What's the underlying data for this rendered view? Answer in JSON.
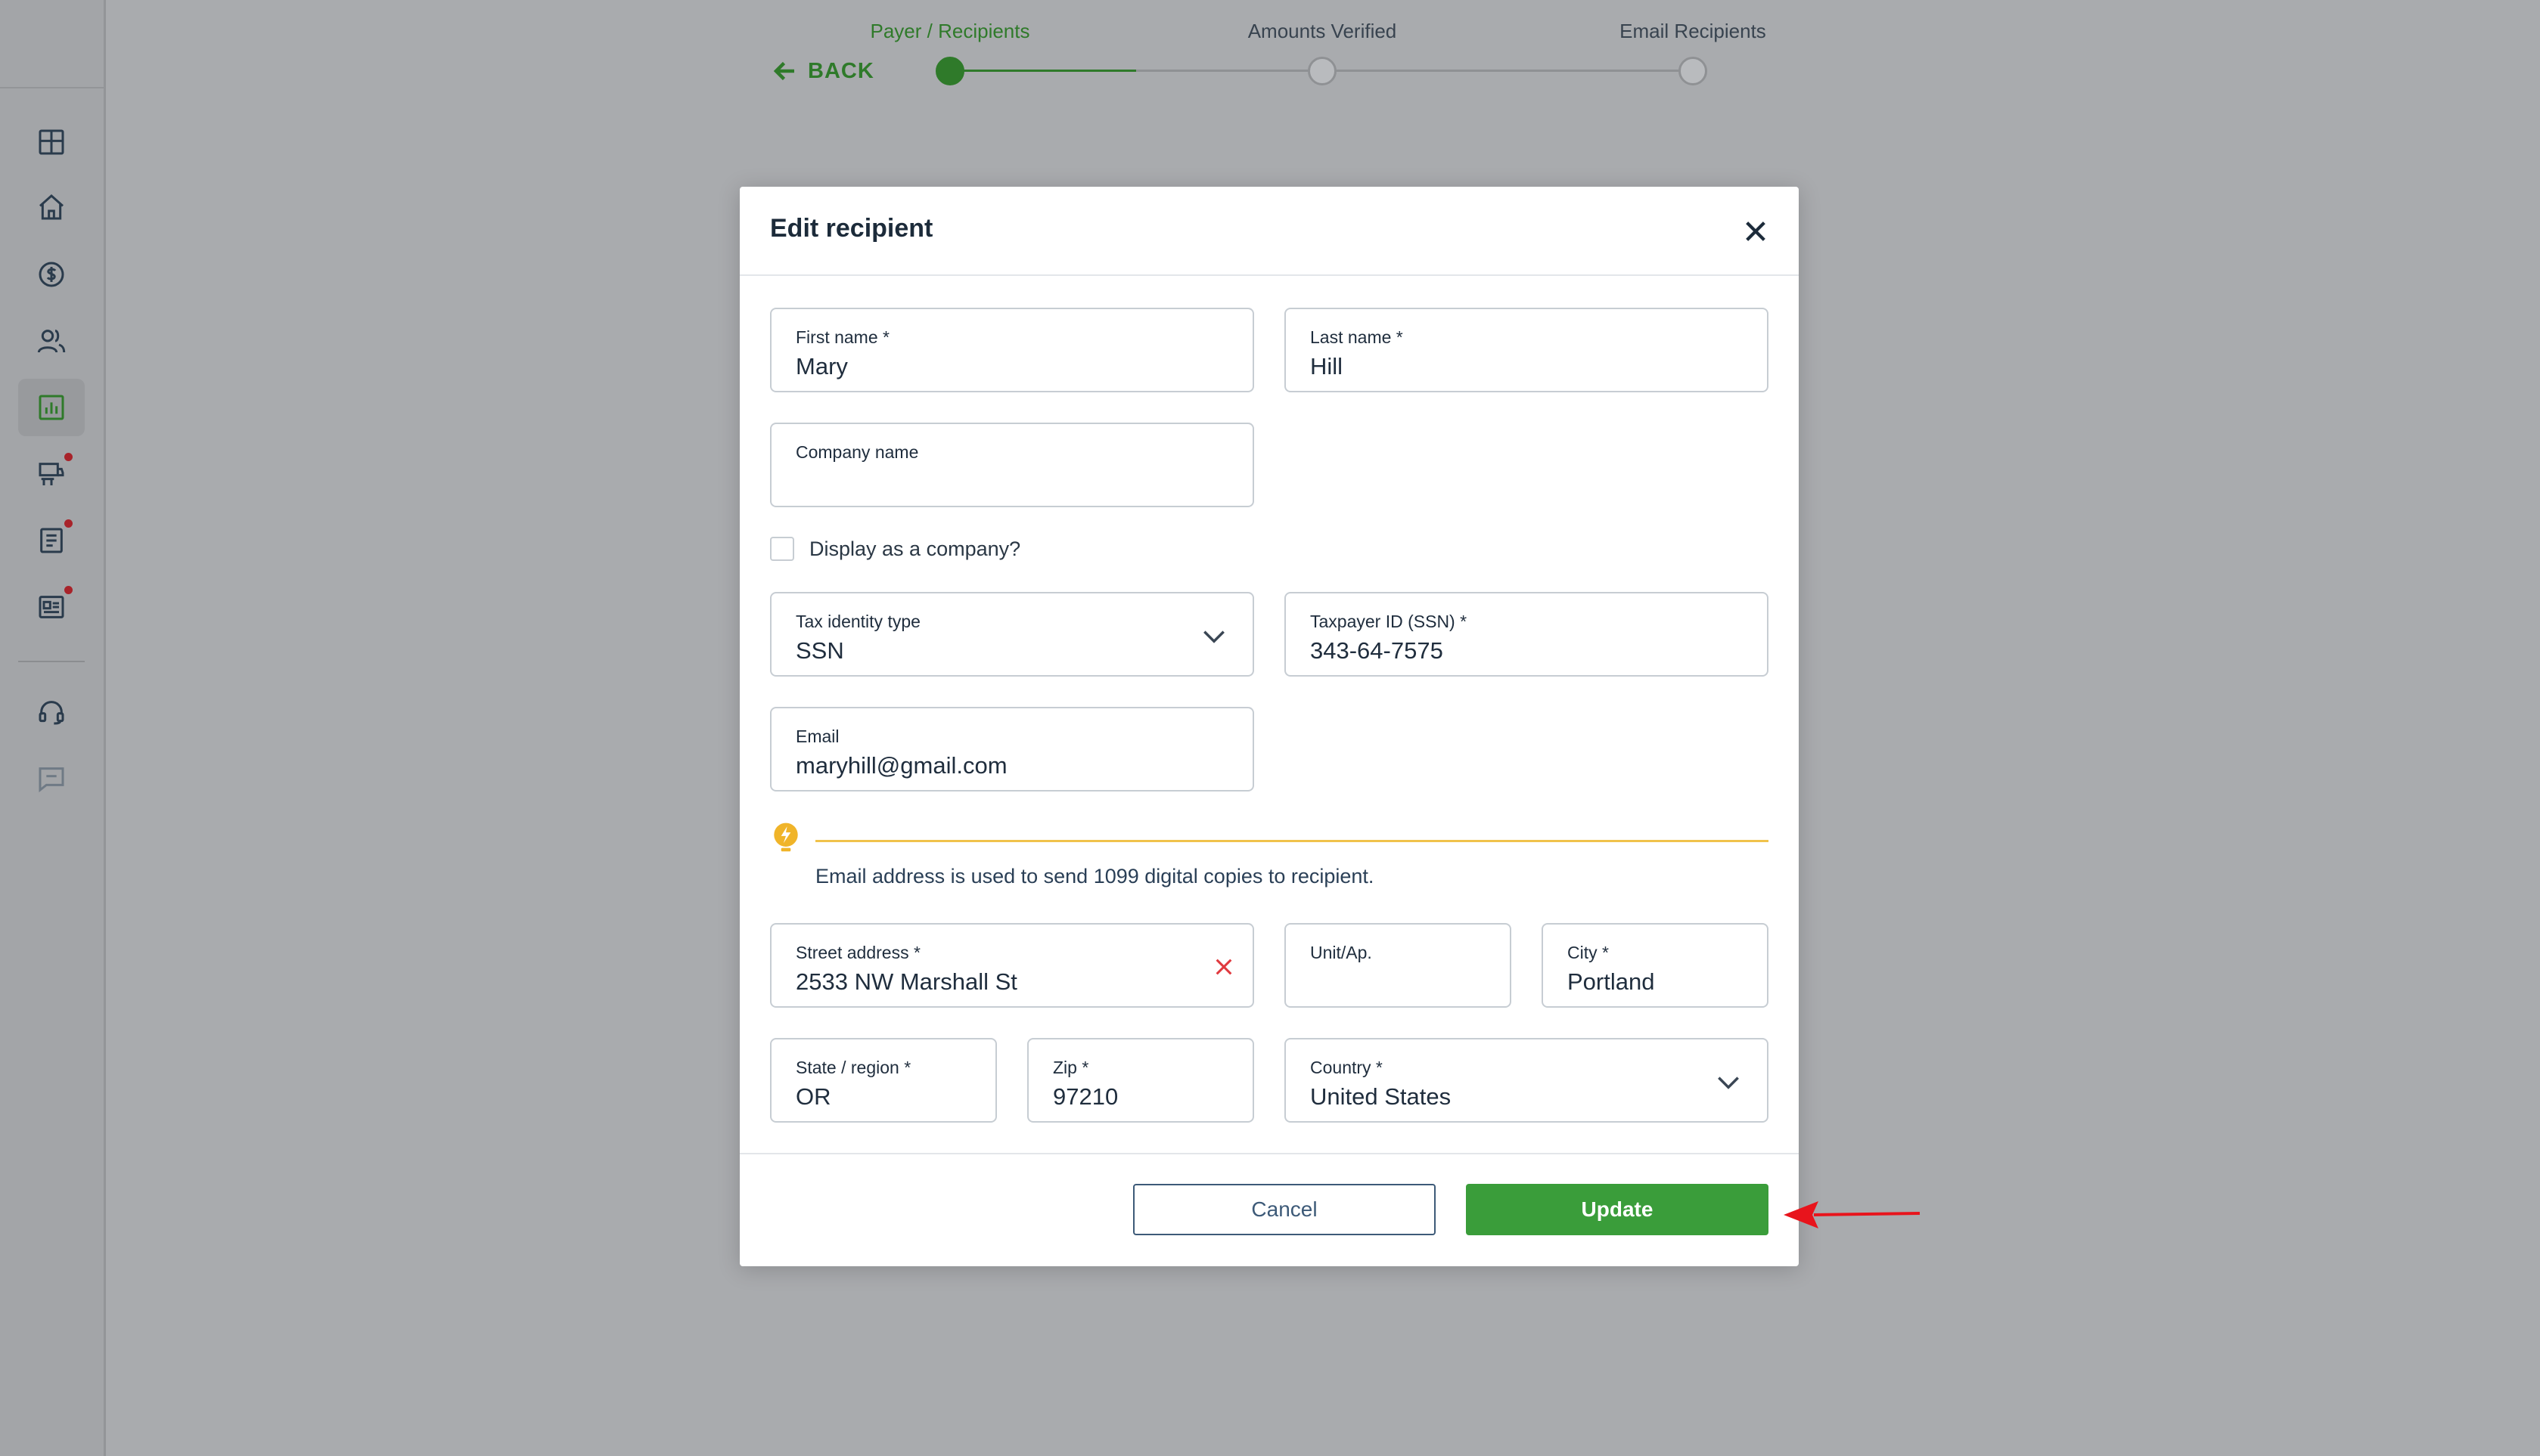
{
  "stepper": {
    "back_label": "BACK",
    "steps": [
      {
        "label": "Payer / Recipients",
        "active": true
      },
      {
        "label": "Amounts Verified",
        "active": false
      },
      {
        "label": "Email Recipients",
        "active": false
      }
    ]
  },
  "sidebar": {
    "items": [
      {
        "icon": "dashboard-icon"
      },
      {
        "icon": "home-icon"
      },
      {
        "icon": "dollar-icon"
      },
      {
        "icon": "users-icon"
      },
      {
        "icon": "chart-icon",
        "active": true
      },
      {
        "icon": "truck-icon",
        "badge": true
      },
      {
        "icon": "document-icon",
        "badge": true
      },
      {
        "icon": "id-card-icon",
        "badge": true
      },
      {
        "icon": "support-headset-icon"
      },
      {
        "icon": "chat-icon"
      }
    ]
  },
  "modal": {
    "title": "Edit recipient",
    "fields": {
      "first_name": {
        "label": "First name *",
        "value": "Mary"
      },
      "last_name": {
        "label": "Last name *",
        "value": "Hill"
      },
      "company_name": {
        "label": "Company name",
        "value": ""
      },
      "tax_identity_type": {
        "label": "Tax identity type",
        "value": "SSN"
      },
      "taxpayer_id": {
        "label": "Taxpayer ID (SSN) *",
        "value": "343-64-7575"
      },
      "email": {
        "label": "Email",
        "value": "maryhill@gmail.com"
      },
      "street_address": {
        "label": "Street address *",
        "value": "2533 NW Marshall St"
      },
      "unit": {
        "label": "Unit/Ap.",
        "value": ""
      },
      "city": {
        "label": "City *",
        "value": "Portland"
      },
      "state": {
        "label": "State / region *",
        "value": "OR"
      },
      "zip": {
        "label": "Zip *",
        "value": "97210"
      },
      "country": {
        "label": "Country *",
        "value": "United States"
      }
    },
    "display_as_company_label": "Display as a company?",
    "display_as_company_checked": false,
    "tip_text": "Email address is used to send 1099 digital copies to recipient.",
    "cancel_label": "Cancel",
    "update_label": "Update"
  },
  "colors": {
    "accent_green": "#3a9d3a",
    "step_green": "#2f7a2a",
    "tip_yellow": "#f0c24b",
    "annotation_red": "#e8141c"
  }
}
